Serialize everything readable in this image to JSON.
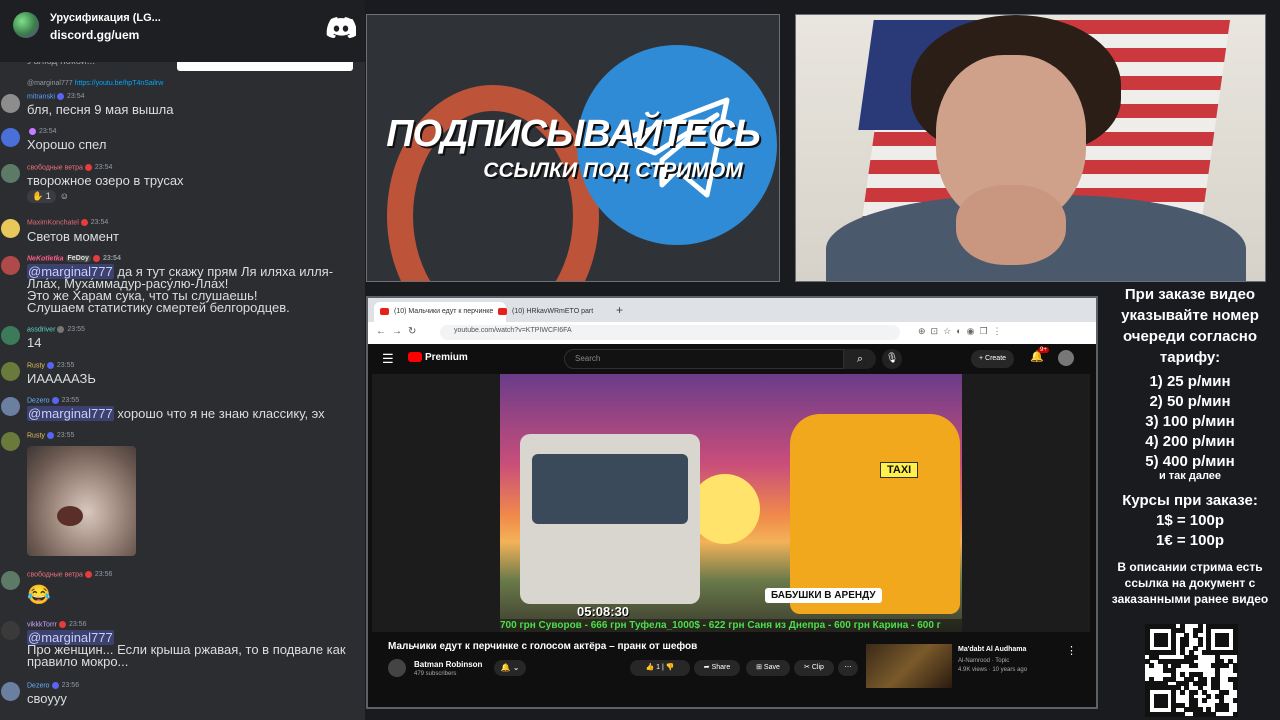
{
  "chat": {
    "server_name": "Урусификация (LG...",
    "invite": "discord.gg/uem",
    "scrolled_text": "Ублюд покой...",
    "messages": [
      {
        "reply_user": "@marginal777",
        "reply_link": "https://youtu.be/hpT4nSailrw"
      },
      {
        "user": "mitranski",
        "user_color": "#5aa0ff",
        "time": "23:54",
        "text": "бля, песня 9 мая вышла"
      },
      {
        "user": "",
        "user_color": "#c77dff",
        "time": "23:54",
        "text": "Хорошо спел"
      },
      {
        "user": "свободные ветра",
        "user_color": "#f07178",
        "time": "23:54",
        "text": "творожное озеро в трусах",
        "reactions": [
          "1",
          "☺"
        ]
      },
      {
        "user": "MaximKonchatel",
        "user_color": "#e06c75",
        "time": "23:54",
        "text": "Светов момент"
      },
      {
        "user": "NeKotletka",
        "user_color": "#ff5c8a",
        "tag": "FeDoy",
        "time": "23:54",
        "mention": "@marginal777",
        "text": " да я тут скажу прям Ля иляха илля-",
        "lines": [
          "Лла́х, Муха́ммадур-расу́лю-Лла́х!",
          "Это же Харам сука, что ты слушаешь!",
          "Слушаем статистику смертей белгородцев."
        ]
      },
      {
        "user": "assdriver",
        "user_color": "#5fd3c6",
        "time": "23:55",
        "text": "14"
      },
      {
        "user": "Rusty",
        "user_color": "#e0c45a",
        "time": "23:55",
        "text": "ИАААААЗЬ"
      },
      {
        "user": "Dezero",
        "user_color": "#6ab0ff",
        "time": "23:55",
        "mention": "@marginal777",
        "text": " хорошо что я не знаю классику, эх"
      },
      {
        "user": "Rusty",
        "user_color": "#e0c45a",
        "time": "23:55",
        "text": ""
      },
      {
        "user": "свободные ветра",
        "user_color": "#f07178",
        "time": "23:56",
        "text": ""
      },
      {
        "user": "vikkkTorrr",
        "user_color": "#c9a4ff",
        "time": "23:56",
        "mention": "@marginal777",
        "text": "",
        "lines": [
          "Про женщин... Если крыша ржавая, то в подвале как",
          "правило мокро..."
        ]
      },
      {
        "user": "Dezero",
        "user_color": "#6ab0ff",
        "time": "23:56",
        "text": "своууу"
      }
    ]
  },
  "promo": {
    "title": "ПОДПИСЫВАЙТЕСЬ",
    "subtitle": "ССЫЛКИ ПОД СТРИМОМ"
  },
  "browser": {
    "tab1": "(10) Мальчики едут к перчинке",
    "tab2": "(10) HRkavWRmETO part",
    "url": "youtube.com/watch?v=KTPIWCFI6FA",
    "logo": "Premium",
    "search_placeholder": "Search",
    "create": "+ Create",
    "notif_count": "9+"
  },
  "video": {
    "timer": "05:08:30",
    "ticker": "700 грн   Суворов - 666 грн   Туфела_1000$ - 622 грн   Саня из Днепра - 600 грн   Карина - 600 г",
    "thumb_sign": "TAXI",
    "thumb_card": "БАБУШКИ В АРЕНДУ",
    "title": "Мальчики едут к перчинке с голосом актёра – пранк от шефов",
    "channel": "Batman Robinson",
    "subs": "479 subscribers",
    "likes": "1",
    "share": "Share",
    "save": "Save",
    "clip": "Clip",
    "rec_title": "Ma'dabt Al Audhama",
    "rec_artist": "Al-Namrood · Topic",
    "rec_views": "4.9K views · 10 years ago"
  },
  "info": {
    "heading": "При заказе видео указывайте номер очереди согласно тарифу:",
    "rates": [
      "1) 25 р/мин",
      "2) 50 р/мин",
      "3) 100 р/мин",
      "4) 200 р/мин",
      "5) 400 р/мин"
    ],
    "etc": "и так далее",
    "courses_title": "Курсы при заказе:",
    "course_usd": "1$ = 100р",
    "course_eur": "1€ = 100р",
    "description": "В описании стрима есть ссылка на документ с заказанными ранее видео"
  },
  "colors": {
    "chat_bg": "#2b2d31",
    "mention_bg": "#3c4270",
    "ticker": "#4cde4c",
    "taxi": "#f2a81c"
  }
}
